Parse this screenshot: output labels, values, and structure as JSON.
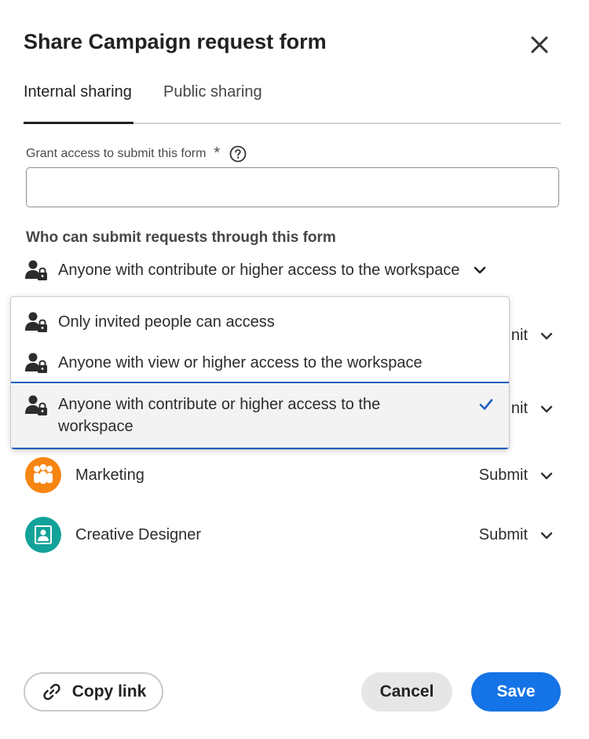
{
  "dialog": {
    "title": "Share Campaign request form"
  },
  "tabs": [
    {
      "label": "Internal sharing",
      "active": true
    },
    {
      "label": "Public sharing",
      "active": false
    }
  ],
  "grant": {
    "label": "Grant access to submit this form",
    "required_mark": "*",
    "value": "",
    "placeholder": ""
  },
  "who": {
    "label": "Who can submit requests through this form",
    "selected": "Anyone with contribute or higher access to the workspace"
  },
  "dropdown": {
    "options": [
      {
        "label": "Only invited people can access",
        "selected": false
      },
      {
        "label": "Anyone with view or higher access to the workspace",
        "selected": false
      },
      {
        "label": "Anyone with contribute or higher access to the workspace",
        "selected": true
      }
    ]
  },
  "hidden_rows": [
    {
      "perm_partial": "nit"
    },
    {
      "perm_partial": "nit"
    }
  ],
  "people": [
    {
      "name": "Marketing",
      "permission": "Submit",
      "avatar_color": "#f68511",
      "icon": "group-icon"
    },
    {
      "name": "Creative Designer",
      "permission": "Submit",
      "avatar_color": "#12a29a",
      "icon": "user-card-icon"
    }
  ],
  "footer": {
    "copy_link": "Copy link",
    "cancel": "Cancel",
    "save": "Save"
  },
  "colors": {
    "accent": "#1473e6",
    "selection_border": "#1f5fbf"
  }
}
